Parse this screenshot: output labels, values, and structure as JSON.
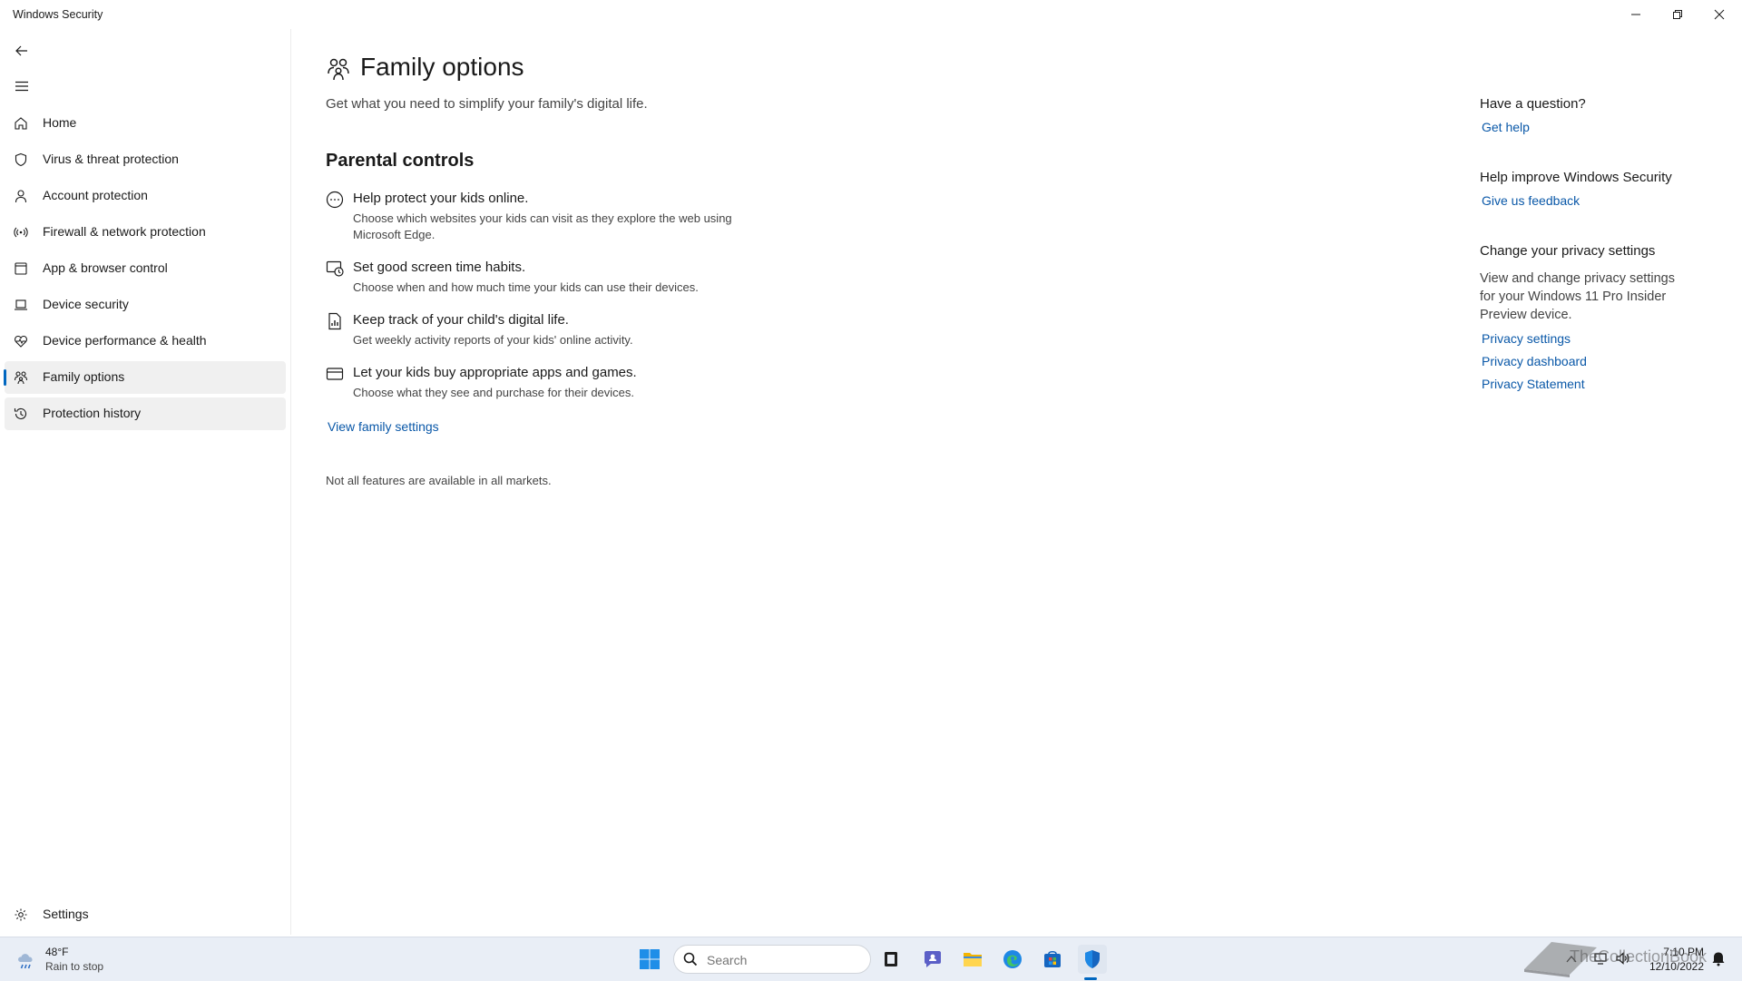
{
  "window": {
    "title": "Windows Security",
    "controls": [
      "minimize-icon",
      "restore-icon",
      "close-icon"
    ]
  },
  "sidebar": {
    "back_icon": "back-arrow-icon",
    "menu_icon": "hamburger-menu-icon",
    "items": [
      {
        "label": "Home",
        "icon": "home-icon"
      },
      {
        "label": "Virus & threat protection",
        "icon": "shield-icon"
      },
      {
        "label": "Account protection",
        "icon": "person-icon"
      },
      {
        "label": "Firewall & network protection",
        "icon": "wireless-signal-icon"
      },
      {
        "label": "App & browser control",
        "icon": "app-window-icon"
      },
      {
        "label": "Device security",
        "icon": "laptop-icon"
      },
      {
        "label": "Device performance & health",
        "icon": "heart-pulse-icon"
      },
      {
        "label": "Family options",
        "icon": "family-icon",
        "active": true
      },
      {
        "label": "Protection history",
        "icon": "history-icon"
      }
    ],
    "settings": {
      "label": "Settings",
      "icon": "gear-icon"
    }
  },
  "main": {
    "title": "Family options",
    "subtitle": "Get what you need to simplify your family's digital life.",
    "section_title": "Parental controls",
    "features": [
      {
        "heading": "Help protect your kids online.",
        "description": "Choose which websites your kids can visit as they explore the web using Microsoft Edge.",
        "icon": "globe-icon"
      },
      {
        "heading": "Set good screen time habits.",
        "description": "Choose when and how much time your kids can use their devices.",
        "icon": "screen-clock-icon"
      },
      {
        "heading": "Keep track of your child's digital life.",
        "description": "Get weekly activity reports of your kids' online activity.",
        "icon": "report-document-icon"
      },
      {
        "heading": "Let your kids buy appropriate apps and games.",
        "description": "Choose what they see and purchase for their devices.",
        "icon": "credit-card-icon"
      }
    ],
    "view_family_link": "View family settings",
    "note": "Not all features are available in all markets."
  },
  "aside": {
    "question": {
      "heading": "Have a question?",
      "link": "Get help"
    },
    "improve": {
      "heading": "Help improve Windows Security",
      "link": "Give us feedback"
    },
    "privacy": {
      "heading": "Change your privacy settings",
      "text": "View and change privacy settings for your Windows 11 Pro Insider Preview device.",
      "links": [
        "Privacy settings",
        "Privacy dashboard",
        "Privacy Statement"
      ]
    }
  },
  "taskbar": {
    "weather": {
      "temp": "48°F",
      "condition": "Rain to stop"
    },
    "search_placeholder": "Search",
    "apps": [
      "windows-start-icon",
      "search-icon",
      "task-view-icon",
      "chat-icon",
      "file-explorer-icon",
      "edge-icon",
      "store-icon",
      "windows-security-icon"
    ],
    "clock": {
      "time": "7:10 PM",
      "date": "12/10/2022"
    },
    "watermark": "TheCollectionBook"
  },
  "colors": {
    "accent": "#0067c0",
    "link": "#0a58a8",
    "taskbar": "#e9eef6"
  }
}
